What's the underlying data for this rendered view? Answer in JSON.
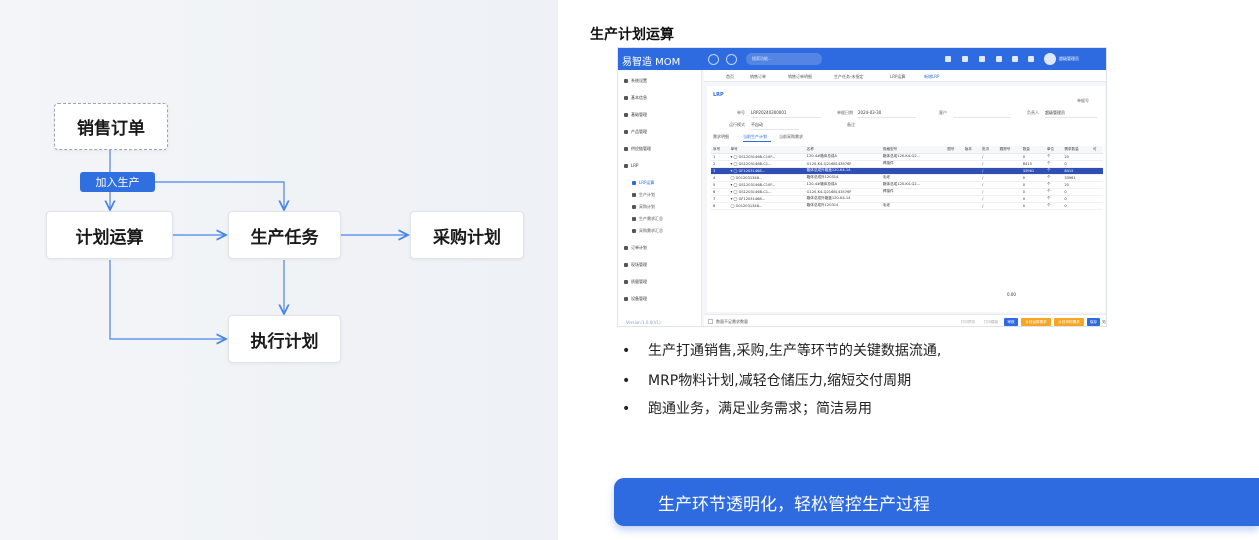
{
  "diagram": {
    "nodes": {
      "sales_order": "销售订单",
      "plan_calc": "计划运算",
      "production_task": "生产任务",
      "purchase_plan": "采购计划",
      "execute_plan": "执行计划"
    },
    "tag_join_production": "加入生产",
    "colors": {
      "accent": "#2f6fe0",
      "arrow": "#4a86e8"
    }
  },
  "section_title": "生产计划运算",
  "app": {
    "logo": "易智造 MOM",
    "search_placeholder": "搜索功能...",
    "username": "超级管理员",
    "sidebar": [
      {
        "label": "系统设置"
      },
      {
        "label": "基本信息"
      },
      {
        "label": "基础管理"
      },
      {
        "label": "产品管理"
      },
      {
        "label": "供应链管理"
      },
      {
        "label": "LRP"
      },
      {
        "label": "LRP运算"
      },
      {
        "label": "生产计划"
      },
      {
        "label": "采购计划"
      },
      {
        "label": "生产需求汇总"
      },
      {
        "label": "采购需求汇总"
      },
      {
        "label": "订单计划"
      },
      {
        "label": "现场管理"
      },
      {
        "label": "质量管理"
      },
      {
        "label": "设备管理"
      }
    ],
    "version": "Version:1.0.0(V1)",
    "tabs": [
      "首页",
      "销售订单",
      "销售订单明细",
      "生产任务-未指定",
      "LRP运算",
      "新增LRP"
    ],
    "header": "LRP",
    "form": {
      "code_label": "单号",
      "code_value": "LRP20240300001",
      "date_label": "单据日期",
      "date_value": "2024-03-30",
      "customer_label": "客户",
      "operator_label": "负责人",
      "operator_value": "超级管理员",
      "status_label": "运行模式",
      "status_value": "不自动",
      "remark_label": "备注",
      "save_label": "单据号"
    },
    "subtabs": [
      "需求明细",
      "当前生产计划",
      "当前采购需求"
    ],
    "table": {
      "headers": [
        "序号",
        "单号",
        "名称",
        "规格型号",
        "图号",
        "版本",
        "批次",
        "跟踪号",
        "数量",
        "单位",
        "需求数量",
        "可"
      ],
      "rows": [
        [
          "1",
          "▾ ◯ GS12031468-C10F...",
          "120-4#箱体总成A",
          "箱体总成120-K4-Q2...",
          "",
          "",
          "/",
          "",
          "0",
          "个",
          "20"
        ],
        [
          "2",
          "▾ ◯ GS12031468-C1...",
          "G120-K4-Q2168143576F",
          "焊接件",
          "",
          "",
          "/",
          "",
          "8415",
          "个",
          "0"
        ],
        [
          "3",
          "▾ ◯ GF12031468...",
          "箱体总成外箱盖120-K4-14",
          "",
          "",
          "",
          "/",
          "",
          "33961",
          "个",
          "8415"
        ],
        [
          "4",
          "◯ G012031348...",
          "箱体总成外120314",
          "毛坯",
          "",
          "",
          "/",
          "",
          "0",
          "个",
          "33961"
        ],
        [
          "5",
          "▾ ◯ GS12031468-C10F...",
          "120-4#箱体总成A",
          "箱体总成120-K4-Q2...",
          "",
          "",
          "/",
          "",
          "0",
          "个",
          "20"
        ],
        [
          "6",
          "▾ ◯ GS12031468-C1...",
          "G120-K4-Q2168143576F",
          "焊接件",
          "",
          "",
          "/",
          "",
          "0",
          "个",
          "0"
        ],
        [
          "7",
          "▾ ◯ GF12031468...",
          "箱体总成外箱盖120-K4-14",
          "",
          "",
          "",
          "/",
          "",
          "0",
          "个",
          "0"
        ],
        [
          "8",
          "◯ G012031348...",
          "箱体总成外120314",
          "毛坯",
          "",
          "",
          "/",
          "",
          "0",
          "个",
          "0"
        ]
      ],
      "total": "0.00"
    },
    "bottom": {
      "checkbox_label": "数量不足需求数量",
      "buttons": [
        "打印预览",
        "打印模板",
        "审核",
        "计划运算需求",
        "计划采购需求",
        "保存",
        "关闭"
      ]
    }
  },
  "bullets": [
    "生产打通销售,采购,生产等环节的关键数据流通,",
    "MRP物料计划,减轻仓储压力,缩短交付周期",
    "跑通业务，满足业务需求；简洁易用"
  ],
  "banner": "生产环节透明化，轻松管控生产过程"
}
